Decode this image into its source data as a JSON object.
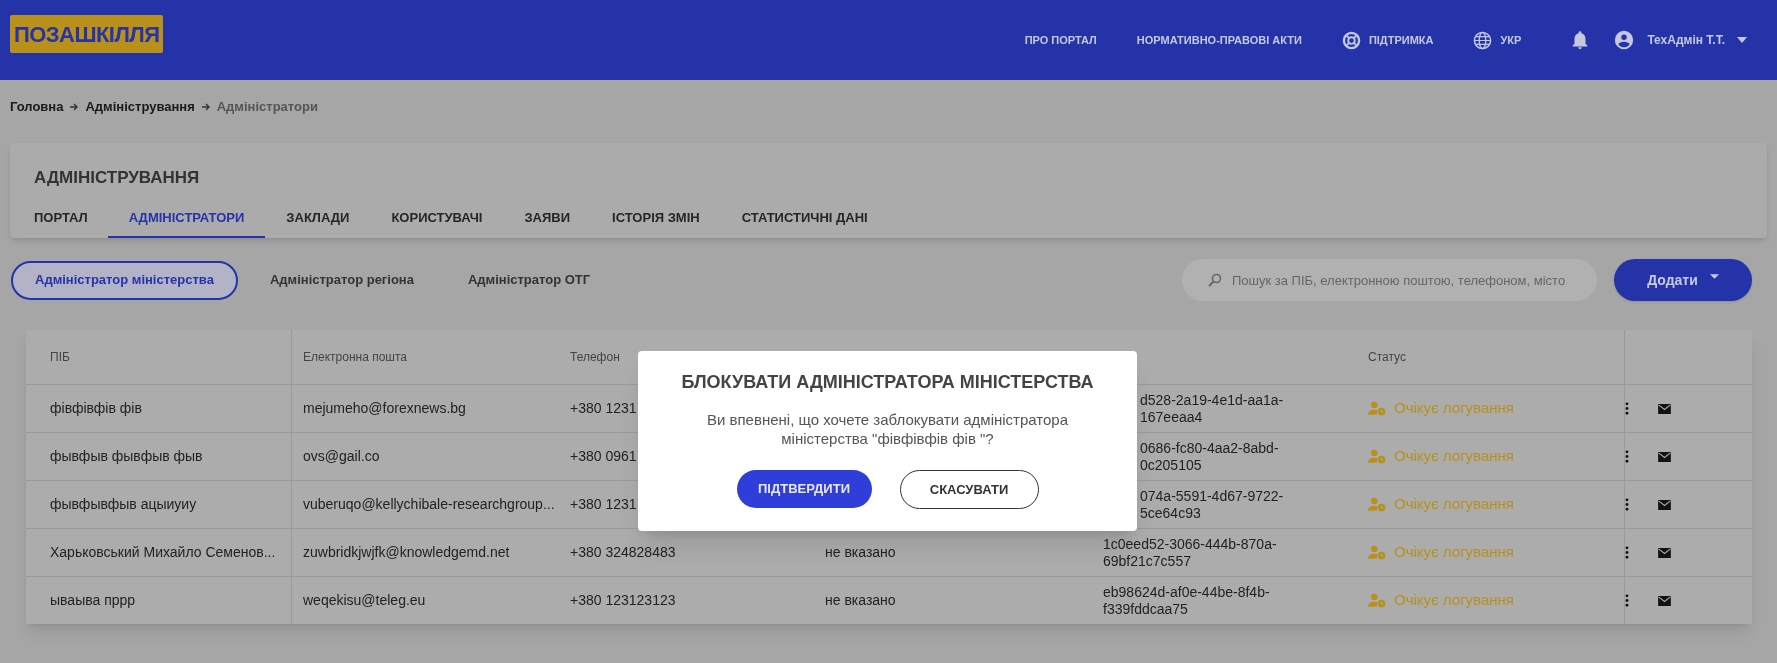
{
  "header": {
    "logo": "ПОЗАШКІЛЛЯ",
    "nav": [
      {
        "kind": "link",
        "label": "ПРО ПОРТАЛ"
      },
      {
        "kind": "link",
        "label": "НОРМАТИВНО-ПРАВОВІ АКТИ"
      },
      {
        "kind": "support",
        "label": "ПІДТРИМКА"
      },
      {
        "kind": "language",
        "label": "УКР"
      }
    ],
    "user": "ТехАдмін Т.Т."
  },
  "breadcrumb": [
    {
      "label": "Головна",
      "current": false
    },
    {
      "label": "Адміністрування",
      "current": false
    },
    {
      "label": "Адміністратори",
      "current": true
    }
  ],
  "section": {
    "title": "АДМІНІСТРУВАННЯ",
    "tabs": [
      {
        "label": "ПОРТАЛ",
        "selected": false
      },
      {
        "label": "АДМІНІСТРАТОРИ",
        "selected": true
      },
      {
        "label": "ЗАКЛАДИ",
        "selected": false
      },
      {
        "label": "КОРИСТУВАЧІ",
        "selected": false
      },
      {
        "label": "ЗАЯВИ",
        "selected": false
      },
      {
        "label": "ІСТОРІЯ ЗМІН",
        "selected": false
      },
      {
        "label": "СТАТИСТИЧНІ ДАНІ",
        "selected": false
      }
    ]
  },
  "filters": [
    {
      "label": "Адміністратор міністерства",
      "selected": true
    },
    {
      "label": "Адміністратор регіона",
      "selected": false
    },
    {
      "label": "Адміністратор ОТГ",
      "selected": false
    }
  ],
  "search": {
    "placeholder": "Пошук за ПІБ, електронною поштою, телефоном, місто"
  },
  "add_button": "Додати",
  "table": {
    "columns": [
      "ПІБ",
      "Електронна пошта",
      "Телефон",
      "Статус"
    ],
    "rows": [
      {
        "name": "фівфівфів фів",
        "email": "mejumeho@forexnews.bg",
        "phone": "+380 1231",
        "column_5": [
          "d528-2a19-4e1d-aa1a-",
          "167eeaa4"
        ],
        "status": "Очікує логування"
      },
      {
        "name": "фывфыв фывфыв фыв",
        "email": "ovs@gail.co",
        "phone": "+380 0961",
        "column_5": [
          "0686-fc80-4aa2-8abd-",
          "0c205105"
        ],
        "status": "Очікує логування"
      },
      {
        "name": "фывфывфыв ацыиуиу",
        "email": "vuberuqo@kellychibale-researchgroup...",
        "phone": "+380 1231",
        "column_5": [
          "074a-5591-4d67-9722-",
          "5ce64c93"
        ],
        "status": "Очікує логування"
      },
      {
        "name": "Харьковський Михайло Семенов...",
        "email": "zuwbridkjwjfk@knowledgemd.net",
        "phone": "+380 324828483",
        "column_4": "не вказано",
        "column_5": [
          "1c0eed52-3066-444b-870a-",
          "69bf21c7c557"
        ],
        "status": "Очікує логування"
      },
      {
        "name": "ываыва пррр",
        "email": "weqekisu@teleg.eu",
        "phone": "+380 123123123",
        "column_4": "не вказано",
        "column_5": [
          "eb98624d-af0e-44be-8f4b-",
          "f339fddcaa75"
        ],
        "status": "Очікує логування"
      }
    ]
  },
  "dialog": {
    "title": "БЛОКУВАТИ АДМІНІСТРАТОРА МІНІСТЕРСТВА",
    "message": "Ви впевнені, що хочете заблокувати адміністратора міністерства \"фівфівфів фів \"?",
    "confirm": "ПІДТВЕРДИТИ",
    "cancel": "СКАСУВАТИ"
  }
}
